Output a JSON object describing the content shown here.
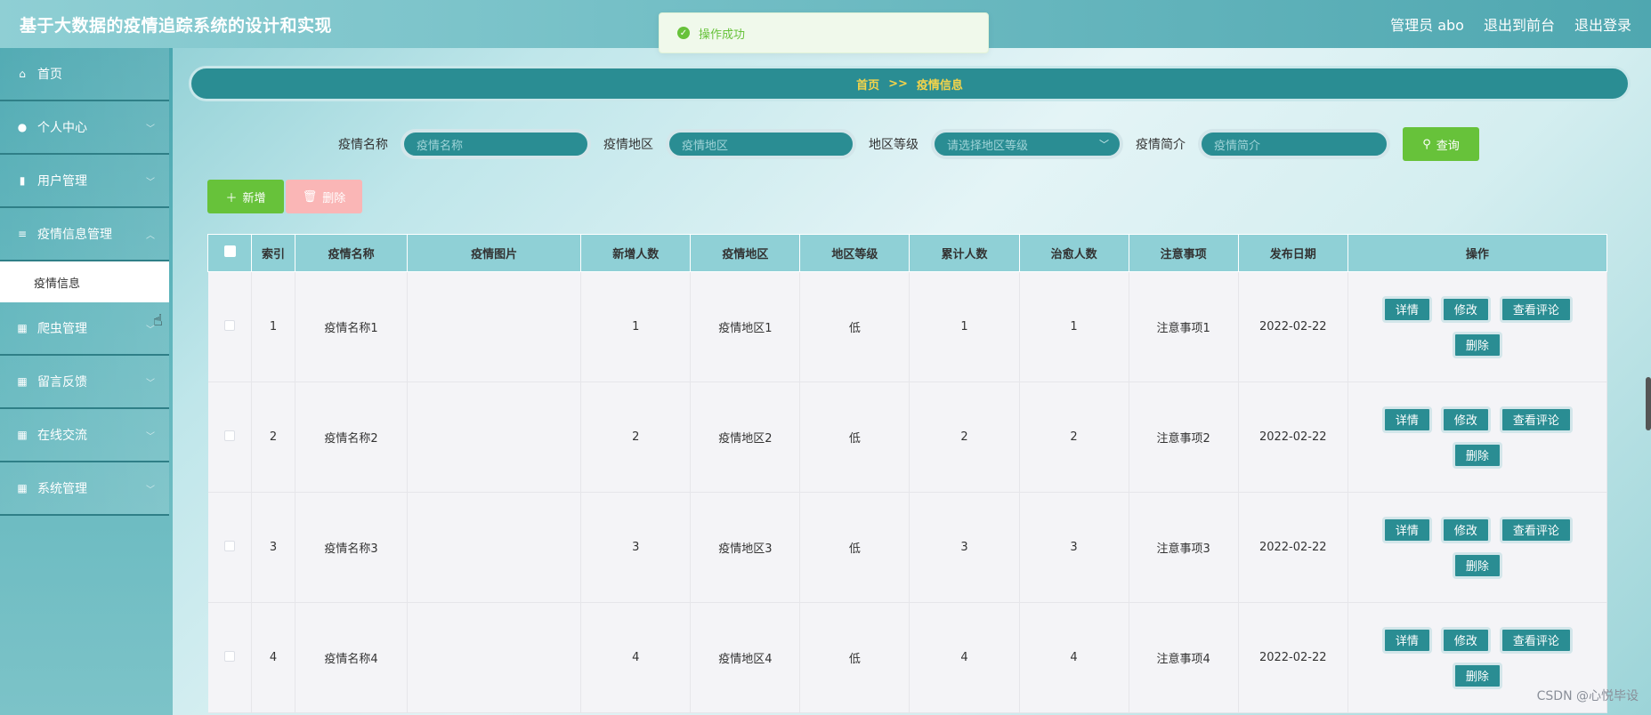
{
  "header": {
    "title": "基于大数据的疫情追踪系统的设计和实现",
    "admin": "管理员 abo",
    "to_front": "退出到前台",
    "logout": "退出登录"
  },
  "toast": {
    "message": "操作成功"
  },
  "sidebar": {
    "items": [
      {
        "label": "首页",
        "icon": "home-icon"
      },
      {
        "label": "个人中心",
        "icon": "user-icon"
      },
      {
        "label": "用户管理",
        "icon": "bar-chart-icon"
      },
      {
        "label": "疫情信息管理",
        "icon": "sliders-icon"
      },
      {
        "label": "爬虫管理",
        "icon": "grid-icon"
      },
      {
        "label": "留言反馈",
        "icon": "grid-icon"
      },
      {
        "label": "在线交流",
        "icon": "grid-icon"
      },
      {
        "label": "系统管理",
        "icon": "grid-icon"
      }
    ],
    "active_sub": "疫情信息"
  },
  "breadcrumb": {
    "home": "首页",
    "sep": ">>",
    "current": "疫情信息"
  },
  "search": {
    "name_label": "疫情名称",
    "name_placeholder": "疫情名称",
    "area_label": "疫情地区",
    "area_placeholder": "疫情地区",
    "level_label": "地区等级",
    "level_placeholder": "请选择地区等级",
    "brief_label": "疫情简介",
    "brief_placeholder": "疫情简介",
    "query_label": "查询"
  },
  "actions": {
    "add_label": "新增",
    "delete_label": "删除"
  },
  "table": {
    "headers": [
      "索引",
      "疫情名称",
      "疫情图片",
      "新增人数",
      "疫情地区",
      "地区等级",
      "累计人数",
      "治愈人数",
      "注意事项",
      "发布日期",
      "操作"
    ],
    "rows": [
      {
        "index": "1",
        "name": "疫情名称1",
        "new": "1",
        "area": "疫情地区1",
        "level": "低",
        "total": "1",
        "cured": "1",
        "notes": "注意事项1",
        "date": "2022-02-22"
      },
      {
        "index": "2",
        "name": "疫情名称2",
        "new": "2",
        "area": "疫情地区2",
        "level": "低",
        "total": "2",
        "cured": "2",
        "notes": "注意事项2",
        "date": "2022-02-22"
      },
      {
        "index": "3",
        "name": "疫情名称3",
        "new": "3",
        "area": "疫情地区3",
        "level": "低",
        "total": "3",
        "cured": "3",
        "notes": "注意事项3",
        "date": "2022-02-22"
      },
      {
        "index": "4",
        "name": "疫情名称4",
        "new": "4",
        "area": "疫情地区4",
        "level": "低",
        "total": "4",
        "cured": "4",
        "notes": "注意事项4",
        "date": "2022-02-22"
      }
    ],
    "ops": {
      "detail": "详情",
      "edit": "修改",
      "comments": "查看评论",
      "delete": "删除"
    }
  },
  "watermark": "CSDN @心悦毕设",
  "colors": {
    "accent": "#2a8d93",
    "success": "#67c23a",
    "danger_light": "#fab6b6",
    "breadcrumb_text": "#f5d44a"
  }
}
